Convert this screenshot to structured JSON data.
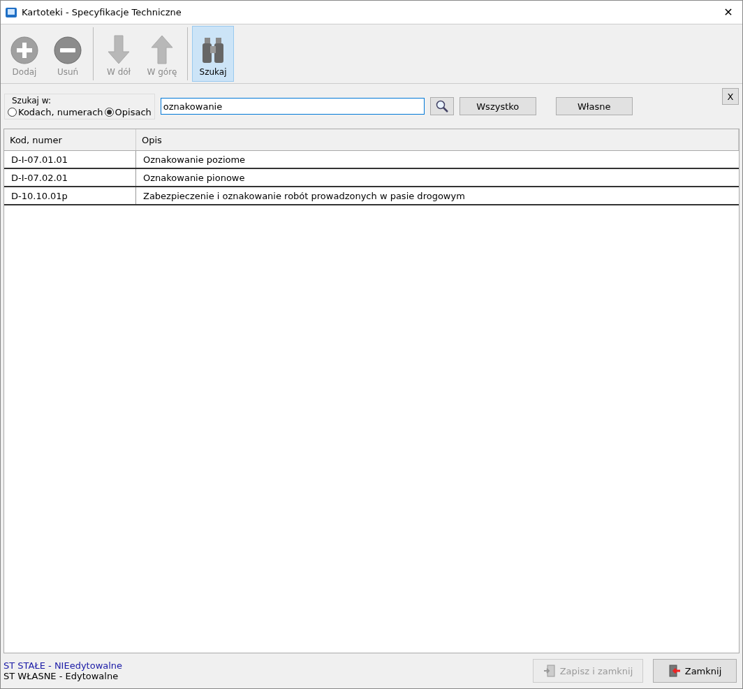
{
  "window": {
    "title": "Kartoteki - Specyfikacje Techniczne",
    "close": "✕"
  },
  "toolbar": [
    {
      "kind": "add",
      "label": "Dodaj",
      "disabled": true,
      "selected": false
    },
    {
      "kind": "remove",
      "label": "Usuń",
      "disabled": true,
      "selected": false
    },
    {
      "kind": "down",
      "label": "W dół",
      "disabled": true,
      "selected": false
    },
    {
      "kind": "up",
      "label": "W górę",
      "disabled": true,
      "selected": false
    },
    {
      "kind": "search",
      "label": "Szukaj",
      "disabled": false,
      "selected": true
    }
  ],
  "search": {
    "group_label": "Szukaj w:",
    "options": [
      {
        "label": "Kodach, numerach",
        "selected": false
      },
      {
        "label": "Opisach",
        "selected": true
      }
    ],
    "value": "oznakowanie",
    "buttons": [
      "Wszystko",
      "Własne"
    ],
    "close": "X"
  },
  "table": {
    "columns": [
      "Kod, numer",
      "Opis"
    ],
    "rows": [
      [
        "D-I-07.01.01",
        "Oznakowanie poziome"
      ],
      [
        "D-I-07.02.01",
        "Oznakowanie pionowe"
      ],
      [
        "D-10.10.01p",
        "Zabezpieczenie i oznakowanie robót prowadzonych w pasie drogowym"
      ]
    ]
  },
  "legend": [
    {
      "text": "ST STAŁE - NIEedytowalne",
      "color": "#1a1aa6"
    },
    {
      "text": "ST WŁASNE - Edytowalne",
      "color": "#000000"
    }
  ],
  "footer_buttons": [
    {
      "kind": "save",
      "label": "Zapisz i zamknij",
      "disabled": true
    },
    {
      "kind": "close",
      "label": "Zamknij",
      "disabled": false
    }
  ]
}
